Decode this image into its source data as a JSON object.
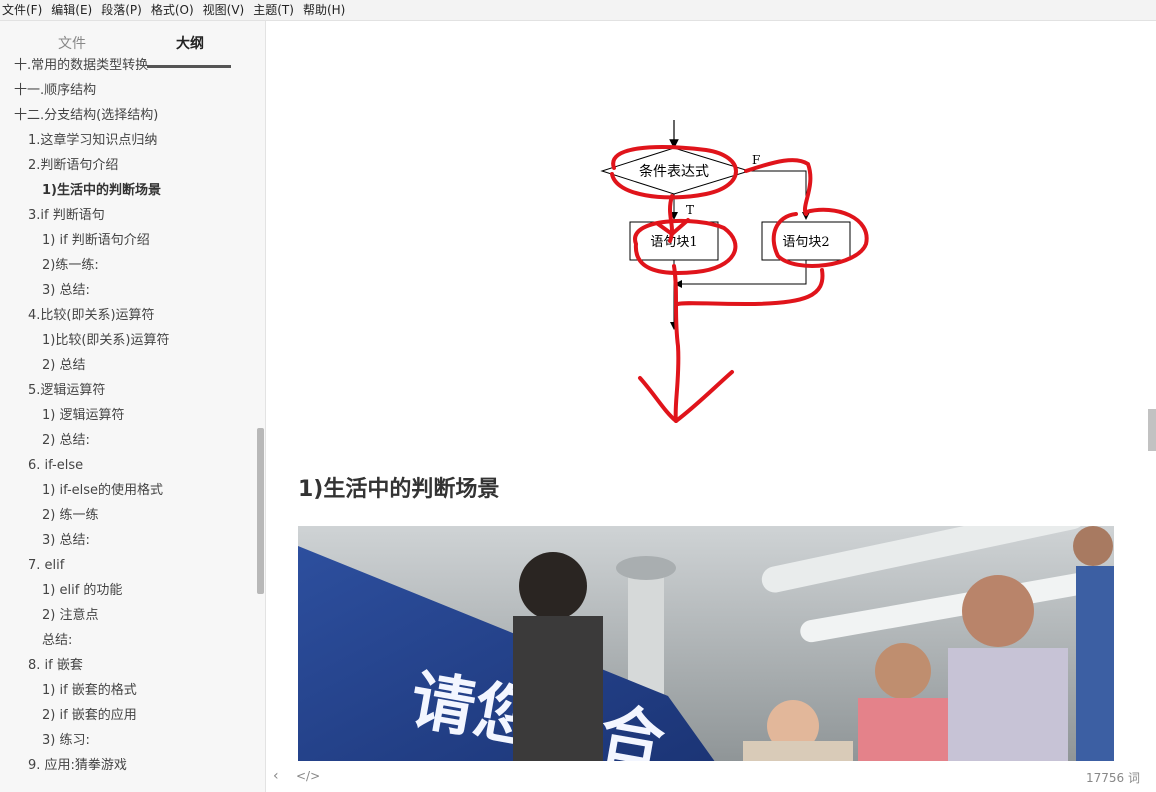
{
  "menu": [
    "文件(F)",
    "编辑(E)",
    "段落(P)",
    "格式(O)",
    "视图(V)",
    "主题(T)",
    "帮助(H)"
  ],
  "sidebar": {
    "tabs": {
      "files": "文件",
      "outline": "大纲"
    },
    "items": [
      {
        "label": "十.常用的数据类型转换",
        "level": 1
      },
      {
        "label": "十一.顺序结构",
        "level": 1
      },
      {
        "label": "十二.分支结构(选择结构)",
        "level": 1
      },
      {
        "label": "1.这章学习知识点归纳",
        "level": 2
      },
      {
        "label": "2.判断语句介绍",
        "level": 2
      },
      {
        "label": "1)生活中的判断场景",
        "level": 3,
        "active": true
      },
      {
        "label": "3.if 判断语句",
        "level": 2
      },
      {
        "label": "1) if 判断语句介绍",
        "level": 3
      },
      {
        "label": "2)练一练:",
        "level": 3
      },
      {
        "label": "3) 总结:",
        "level": 3
      },
      {
        "label": "4.比较(即关系)运算符",
        "level": 2
      },
      {
        "label": "1)比较(即关系)运算符",
        "level": 3
      },
      {
        "label": "2) 总结",
        "level": 3
      },
      {
        "label": "5.逻辑运算符",
        "level": 2
      },
      {
        "label": "1) 逻辑运算符",
        "level": 3
      },
      {
        "label": "2) 总结:",
        "level": 3
      },
      {
        "label": "6. if-else",
        "level": 2
      },
      {
        "label": "1) if-else的使用格式",
        "level": 3
      },
      {
        "label": "2) 练一练",
        "level": 3
      },
      {
        "label": "3) 总结:",
        "level": 3
      },
      {
        "label": "7. elif",
        "level": 2
      },
      {
        "label": "1) elif 的功能",
        "level": 3
      },
      {
        "label": "2) 注意点",
        "level": 3
      },
      {
        "label": "总结:",
        "level": 3
      },
      {
        "label": "8. if 嵌套",
        "level": 2
      },
      {
        "label": "1) if 嵌套的格式",
        "level": 3
      },
      {
        "label": "2) if 嵌套的应用",
        "level": 3
      },
      {
        "label": "3) 练习:",
        "level": 3
      },
      {
        "label": "9. 应用:猜拳游戏",
        "level": 2
      }
    ]
  },
  "flowchart": {
    "condition": "条件表达式",
    "block1": "语句块1",
    "block2": "语句块2",
    "true_label": "T",
    "false_label": "F",
    "annotation_color": "#e0141b"
  },
  "content": {
    "heading": "1)生活中的判断场景",
    "photo_sign_text": "请您配合"
  },
  "status": {
    "words": "17756 词",
    "back_icon": "chevron-left-icon",
    "source_icon": "code-icon"
  }
}
